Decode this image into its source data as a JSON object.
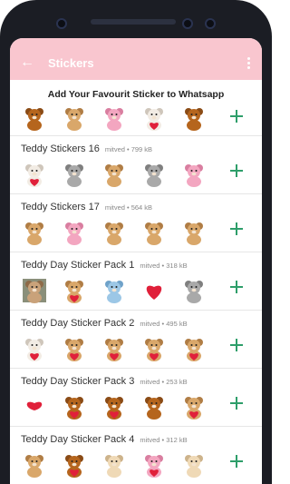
{
  "appbar": {
    "title": "Stickers"
  },
  "header": {
    "text": "Add Your Favourit Sticker to Whatsapp"
  },
  "first_row": {
    "stickers": [
      "bear-brown",
      "bear-tan",
      "bear-pink",
      "bear-white",
      "bear-brown"
    ]
  },
  "packs": [
    {
      "name": "Teddy Stickers 16",
      "author": "mitved",
      "size": "799 kB",
      "stickers": [
        "bear-heart-red",
        "bear-grey",
        "bear-tan",
        "bear-grey",
        "bear-pink"
      ]
    },
    {
      "name": "Teddy Stickers 17",
      "author": "mitved",
      "size": "564 kB",
      "stickers": [
        "bear-couple",
        "bear-pink",
        "bear-couple-brown",
        "bear-couple-brown",
        "bear-tan"
      ]
    },
    {
      "name": "Teddy Day Sticker Pack 1",
      "author": "mitved",
      "size": "318 kB",
      "stickers": [
        "bear-photo",
        "bear-miss-you",
        "bear-blue",
        "heart-red",
        "bear-grey"
      ]
    },
    {
      "name": "Teddy Day Sticker Pack 2",
      "author": "mitved",
      "size": "495 kB",
      "stickers": [
        "bear-heart-red",
        "bear-really-miss-you",
        "bear-my-love",
        "bear-please-come-back",
        "bear-blue-love-hugs"
      ]
    },
    {
      "name": "Teddy Day Sticker Pack 3",
      "author": "mitved",
      "size": "253 kB",
      "stickers": [
        "hearts-small",
        "bear-heart",
        "bear-heart",
        "bear-brown",
        "bear-rose"
      ]
    },
    {
      "name": "Teddy Day Sticker Pack 4",
      "author": "mitved",
      "size": "312 kB",
      "stickers": [
        "bear-tan",
        "bear-heart",
        "bear-cream",
        "bear-heart-pink",
        "bear-cream"
      ]
    }
  ],
  "colors": {
    "accent_bar": "#f9c6cf",
    "add_icon": "#2e9e6a"
  },
  "meta_separator": "•"
}
